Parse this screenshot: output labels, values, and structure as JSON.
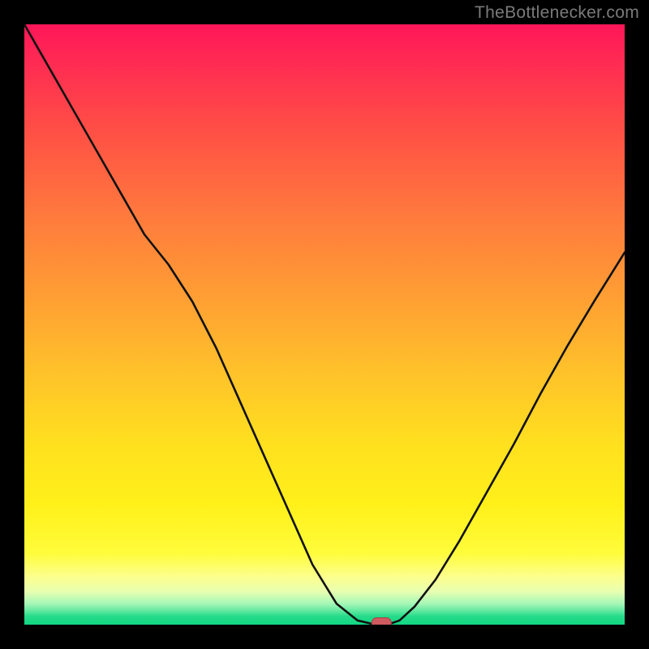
{
  "chart_data": {
    "type": "line",
    "x": [
      0.0,
      0.04,
      0.08,
      0.12,
      0.16,
      0.2,
      0.24,
      0.28,
      0.32,
      0.36,
      0.4,
      0.44,
      0.48,
      0.52,
      0.555,
      0.585,
      0.605,
      0.625,
      0.65,
      0.685,
      0.725,
      0.77,
      0.815,
      0.86,
      0.905,
      0.95,
      1.0
    ],
    "values": [
      100.0,
      93.0,
      86.0,
      79.0,
      72.0,
      65.0,
      60.0,
      53.8,
      46.0,
      37.0,
      28.0,
      19.0,
      10.0,
      3.5,
      0.7,
      0.0,
      0.0,
      0.7,
      3.0,
      7.5,
      14.0,
      22.0,
      30.0,
      38.5,
      46.5,
      54.0,
      62.0
    ],
    "title": "",
    "xlabel": "",
    "ylabel": "",
    "xlim": [
      0,
      1
    ],
    "ylim": [
      0,
      100
    ],
    "marker": {
      "x": 0.595,
      "y": 0.0
    }
  },
  "watermark": "TheBottlenecker.com"
}
